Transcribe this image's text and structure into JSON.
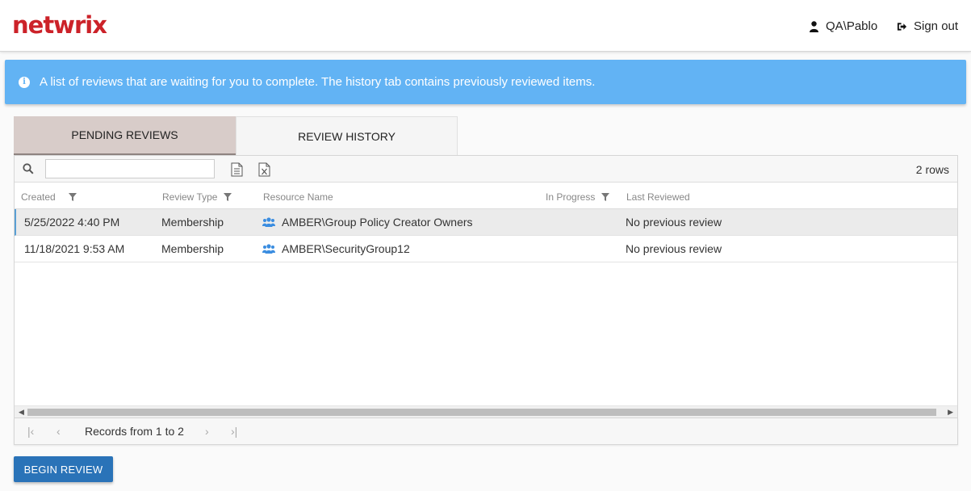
{
  "header": {
    "logo_text": "netwrix",
    "user_name": "QA\\Pablo",
    "signout_label": "Sign out",
    "brand_color": "#cc2229"
  },
  "banner": {
    "text": "A list of reviews that are waiting for you to complete. The history tab contains previously reviewed items.",
    "icon": "info-icon",
    "color": "#62b3f4"
  },
  "tabs": [
    {
      "label": "PENDING REVIEWS",
      "active": true
    },
    {
      "label": "REVIEW HISTORY",
      "active": false
    }
  ],
  "grid": {
    "search_placeholder": "",
    "row_count": "2 rows",
    "columns": [
      "Created",
      "Review Type",
      "Resource Name",
      "In Progress",
      "Last Reviewed"
    ],
    "rows": [
      {
        "created": "5/25/2022 4:40 PM",
        "review_type": "Membership",
        "resource_name": "AMBER\\Group Policy Creator Owners",
        "in_progress": "",
        "last_reviewed": "No previous review",
        "selected": true
      },
      {
        "created": "11/18/2021 9:53 AM",
        "review_type": "Membership",
        "resource_name": "AMBER\\SecurityGroup12",
        "in_progress": "",
        "last_reviewed": "No previous review",
        "selected": false
      }
    ]
  },
  "pager": {
    "text": "Records from 1 to 2"
  },
  "actions": {
    "begin_review_label": "BEGIN REVIEW",
    "button_color": "#2a73b8"
  }
}
